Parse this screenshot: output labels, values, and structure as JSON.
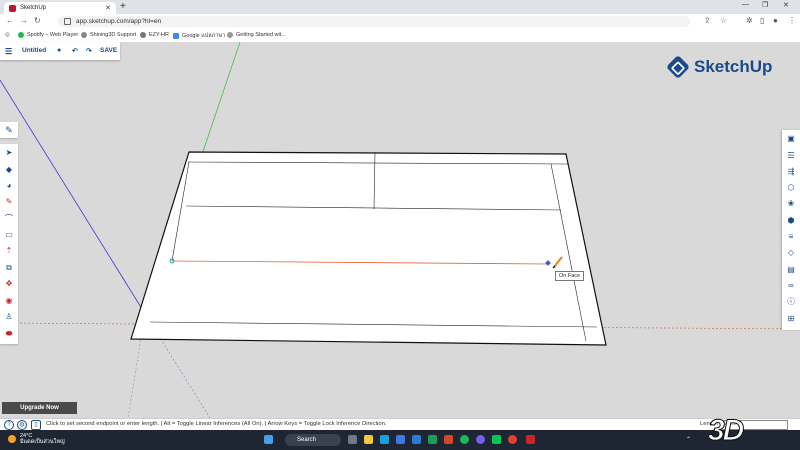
{
  "browser": {
    "tab_title": "SketchUp",
    "url": "app.sketchup.com/app?hl=en",
    "bookmarks": [
      "Spotify – Web Player",
      "Shining3D Support",
      "EZY-HR",
      "Google แปลภาษา",
      "Getting Started wit..."
    ]
  },
  "header": {
    "model_name": "Untitled",
    "save_label": "SAVE"
  },
  "brand": {
    "name": "SketchUp",
    "color": "#1a4a8a"
  },
  "canvas": {
    "tooltip": "On Face"
  },
  "upgrade_label": "Upgrade Now",
  "status": {
    "message": "Click to set second endpoint or enter length.  |  Alt = Toggle Linear Inferences (All On).  |  Arrow Keys = Toggle Lock Inference Direction.",
    "length_label": "Length",
    "length_value": "56 mm"
  },
  "taskbar": {
    "temperature": "24°C",
    "weather": "มีแดดเป็นส่วนใหญ่",
    "search_label": "Search"
  },
  "watermark": "3D"
}
